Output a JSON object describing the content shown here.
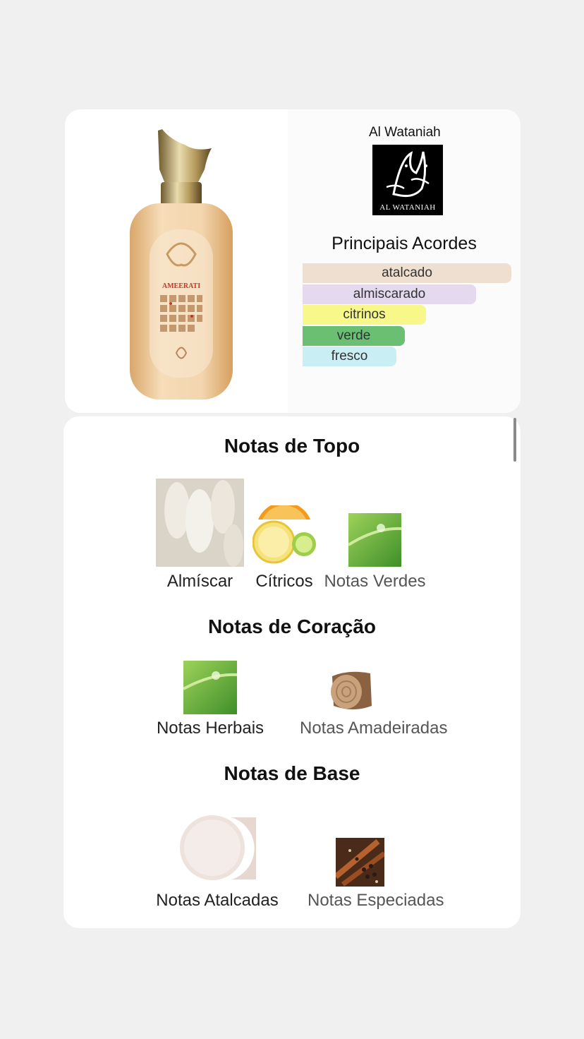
{
  "brand": {
    "name": "Al Wataniah",
    "logo_text": "AL WATANIAH"
  },
  "product": {
    "bottle_label": "AMEERATI"
  },
  "accords": {
    "title": "Principais Acordes",
    "items": [
      {
        "label": "atalcado",
        "color": "#efdfd0",
        "strength": 1.0
      },
      {
        "label": "almiscarado",
        "color": "#e4d9ee",
        "strength": 0.83
      },
      {
        "label": "citrinos",
        "color": "#f7f78a",
        "strength": 0.59
      },
      {
        "label": "verde",
        "color": "#6bbf72",
        "strength": 0.49
      },
      {
        "label": "fresco",
        "color": "#c9eff4",
        "strength": 0.45
      }
    ]
  },
  "notes": {
    "top": {
      "title": "Notas de Topo",
      "items": [
        {
          "label": "Almíscar",
          "icon": "musk-feather-image"
        },
        {
          "label": "Cítricos",
          "icon": "citrus-image"
        },
        {
          "label": "Notas Verdes",
          "icon": "green-leaf-image"
        }
      ]
    },
    "heart": {
      "title": "Notas de Coração",
      "items": [
        {
          "label": "Notas Herbais",
          "icon": "herbal-leaf-image"
        },
        {
          "label": "Notas Amadeiradas",
          "icon": "wood-image"
        }
      ]
    },
    "base": {
      "title": "Notas de Base",
      "items": [
        {
          "label": "Notas Atalcadas",
          "icon": "powder-image"
        },
        {
          "label": "Notas Especiadas",
          "icon": "spices-image"
        }
      ]
    }
  }
}
